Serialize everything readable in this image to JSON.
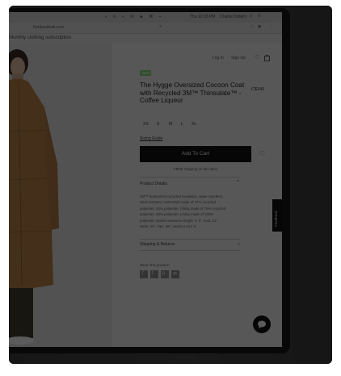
{
  "browser": {
    "clock": "Thu 12:03 PM",
    "user": "Charlie Dobers",
    "url": "frankandoak.com"
  },
  "site": {
    "banner": "Monthly clothing subscription",
    "login_link": "Log In",
    "signup_link": "Sign Up",
    "login_separator": "·"
  },
  "product": {
    "badge": "New",
    "title_line1": "The Hygge Oversized Cocoon Coat",
    "title_line2": "with Recycled 3M™ Thinsulate™ -",
    "title_line3": "Coffee Liqueur",
    "price": "C$345",
    "sizes": [
      "XS",
      "S",
      "M",
      "L",
      "XL"
    ],
    "size_guide": "Sizing Guide",
    "add_to_cart": "Add To Cart",
    "shipping_note": "FREE shipping on this item!",
    "details_heading": "Product Details",
    "details_lines": [
      "3M™ featherless recycled insulation, water repellent,",
      "wind resistant. Outershell made of 37% recycled",
      "polyester, 40% polyester. Filling made of 75% recycled",
      "polyester, 25% polyester. Lining made of 100%",
      "polyester. Model measures height: 5' 9\", bust: 31\",",
      "waist: 24\", hips: 35\"; wears a size S."
    ],
    "shipping_heading": "Shipping & Returns",
    "share_label": "Share this product:"
  },
  "feedback_tab": "Feedback",
  "icons": {
    "wishlist": "heart-icon",
    "cart": "shopping-bag-icon",
    "chat": "chat-bubble-icon",
    "share": [
      "facebook-icon",
      "twitter-icon",
      "pinterest-icon",
      "email-icon"
    ]
  }
}
